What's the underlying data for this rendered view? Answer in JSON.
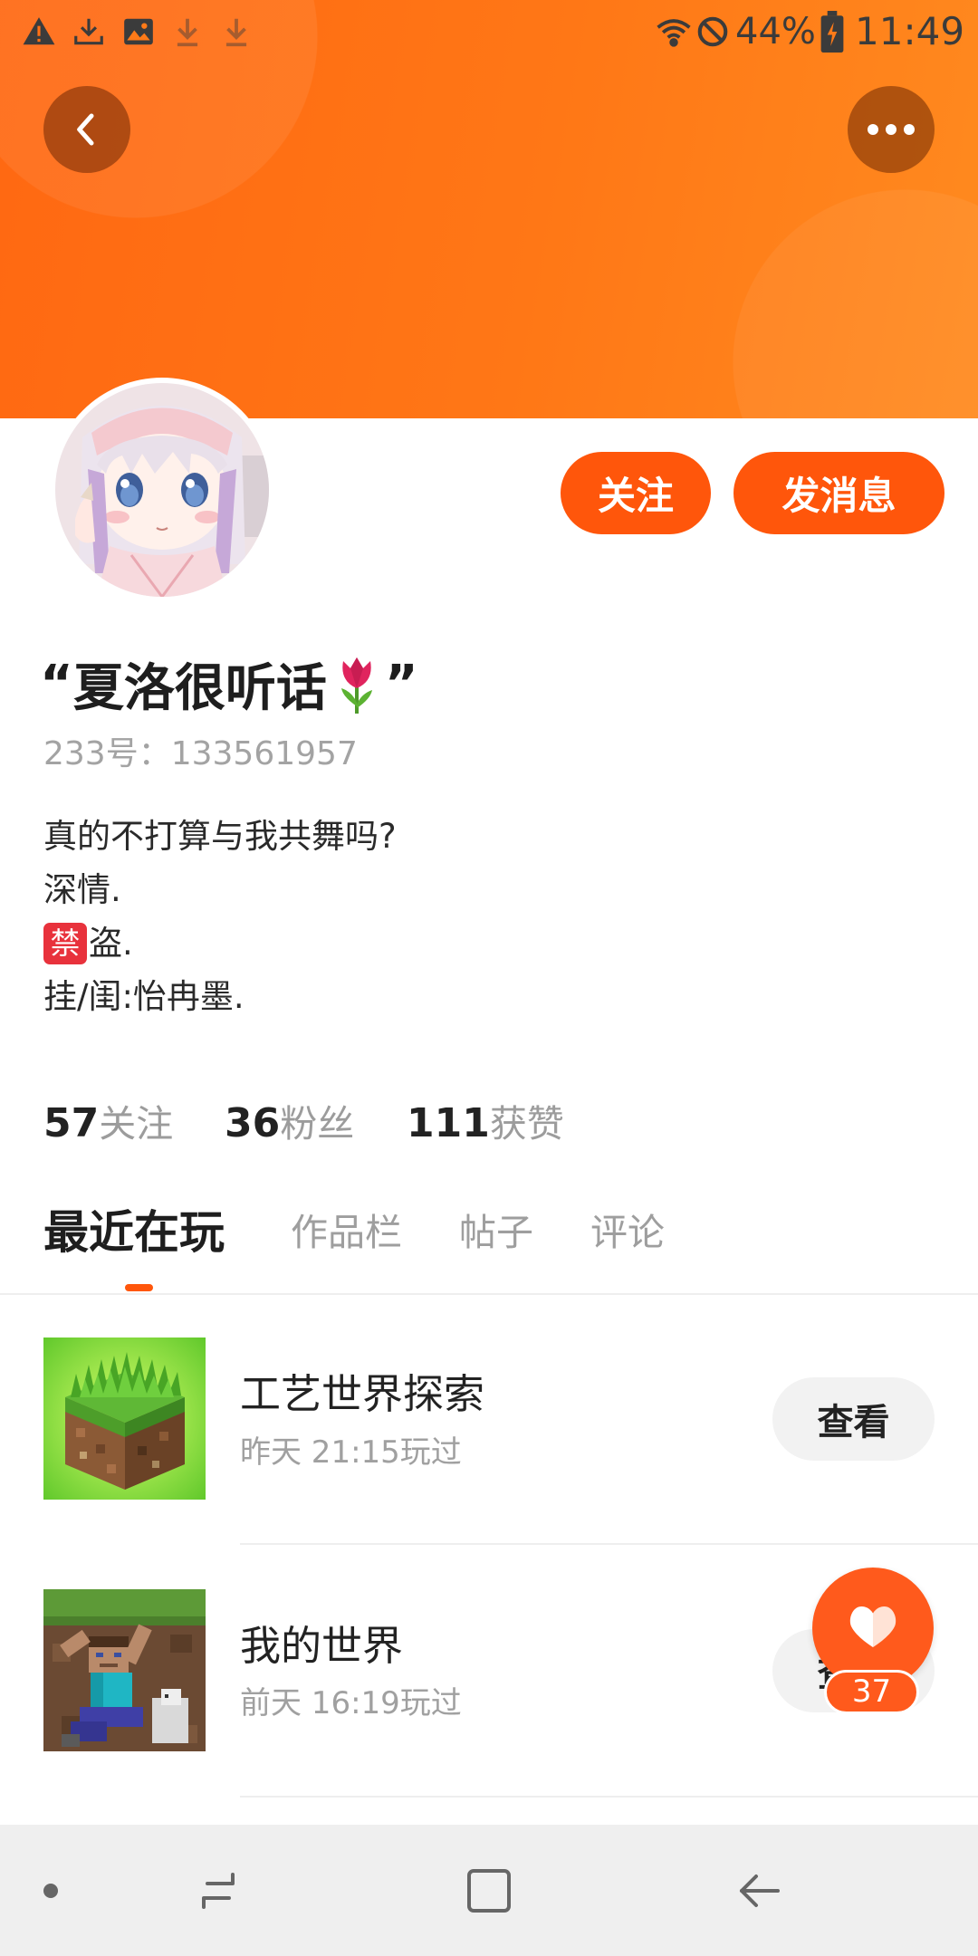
{
  "status_bar": {
    "left_icons": [
      "warning-icon",
      "download-tray-icon",
      "image-icon",
      "download-arrow-icon",
      "download-arrow-icon"
    ],
    "right_icons": [
      "wifi-icon",
      "do-not-disturb-icon",
      "battery-charging-icon"
    ],
    "battery": "44%",
    "time": "11:49"
  },
  "header": {
    "back_icon": "back-chevron-icon",
    "more_icon": "more-dots-icon",
    "gradient_colors": [
      "#ff6812",
      "#ff8a1f"
    ]
  },
  "profile": {
    "avatar": "anime-girl-avatar",
    "follow_label": "关注",
    "message_label": "发消息",
    "quote_open": "“",
    "name": "夏洛很听话",
    "name_emoji": "tulip-emoji",
    "quote_close": "”",
    "user_id": "233号：133561957",
    "bio": {
      "line1": "真的不打算与我共舞吗?",
      "line2": "深情.",
      "line3_badge": "禁",
      "line3_text": "盗.",
      "line4": "挂/闺:怡冉墨."
    }
  },
  "stats": [
    {
      "count": "57",
      "label": "关注"
    },
    {
      "count": "36",
      "label": "粉丝"
    },
    {
      "count": "111",
      "label": "获赞"
    }
  ],
  "tabs": [
    {
      "label": "最近在玩",
      "active": true
    },
    {
      "label": "作品栏",
      "active": false
    },
    {
      "label": "帖子",
      "active": false
    },
    {
      "label": "评论",
      "active": false
    }
  ],
  "games": [
    {
      "icon": "grass-block-game-icon",
      "title": "工艺世界探索",
      "played": "昨天 21:15玩过",
      "button": "查看"
    },
    {
      "icon": "minecraft-steve-game-icon",
      "title": "我的世界",
      "played": "前天 16:19玩过",
      "button": "查看"
    }
  ],
  "like_fab": {
    "icon": "heart-icon",
    "count": "37"
  },
  "nav_bar": {
    "icons": [
      "nav-dot-icon",
      "recent-apps-icon",
      "home-square-icon",
      "back-arrow-icon"
    ]
  },
  "colors": {
    "accent": "#ff560b",
    "fab": "#ff5a1c",
    "ban_badge": "#e8323c"
  }
}
